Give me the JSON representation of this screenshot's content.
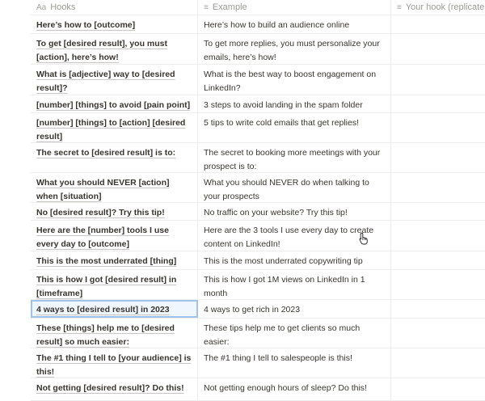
{
  "columns": [
    {
      "icon": "Aa",
      "label": "Hooks"
    },
    {
      "icon": "≡",
      "label": "Example"
    },
    {
      "icon": "≡",
      "label": "Your hook (replicate th"
    }
  ],
  "rows": [
    {
      "hook": "Here’s how to [outcome]",
      "example": "Here’s how to build an audience online",
      "h": 22
    },
    {
      "hook": "To get [desired result], you must [action], here’s how!",
      "example": "To get more replies, you must personalize your emails, here’s how!",
      "h": 37
    },
    {
      "hook": "What is [adjective] way to [desired result]?",
      "example": "What is the best way to boost engagement on LinkedIn?",
      "h": 37
    },
    {
      "hook": "[number] [things] to avoid [pain point]",
      "example": "3 steps to avoid landing in the spam folder",
      "h": 21
    },
    {
      "hook": "[number] [things] to [action] [desired result]",
      "example": "5 tips to write cold emails that get replies!",
      "h": 36
    },
    {
      "hook": "The secret to [desired result] is to:",
      "example": "The secret to booking more meetings with your prospect is to:",
      "h": 36
    },
    {
      "hook": "What you should NEVER [action] when [situation]",
      "example": "What you should NEVER do when talking to your prospects",
      "h": 36
    },
    {
      "hook": "No [desired result]? Try this tip!",
      "example": "No traffic on your website? Try this tip!",
      "h": 21
    },
    {
      "hook": "Here are the [number] tools I use every day to [outcome]",
      "example": "Here are the 3 tools I use every day to create content on LinkedIn!",
      "h": 37
    },
    {
      "hook": "This is the most underrated [thing]",
      "example": "This is the most underrated copywriting tip",
      "h": 22
    },
    {
      "hook": "This is how I got [desired result] in [timeframe]",
      "example": "This is how I got 1M views on LinkedIn in 1 month",
      "h": 36
    },
    {
      "hook": "4 ways to [desired result] in 2023",
      "example": "4 ways to get rich in 2023",
      "h": 22,
      "selected": true
    },
    {
      "hook": "These [things] help me to [desired result] so much easier:",
      "example": "These tips help me to get clients so much easier:",
      "h": 36
    },
    {
      "hook": "The #1 thing I tell to [your audience] is this!",
      "example": "The #1 thing I tell to salespeople is this!",
      "h": 36
    },
    {
      "hook": "Not getting [desired result]? Do this!",
      "example": "Not getting enough hours of sleep? Do this!",
      "h": 27
    }
  ]
}
